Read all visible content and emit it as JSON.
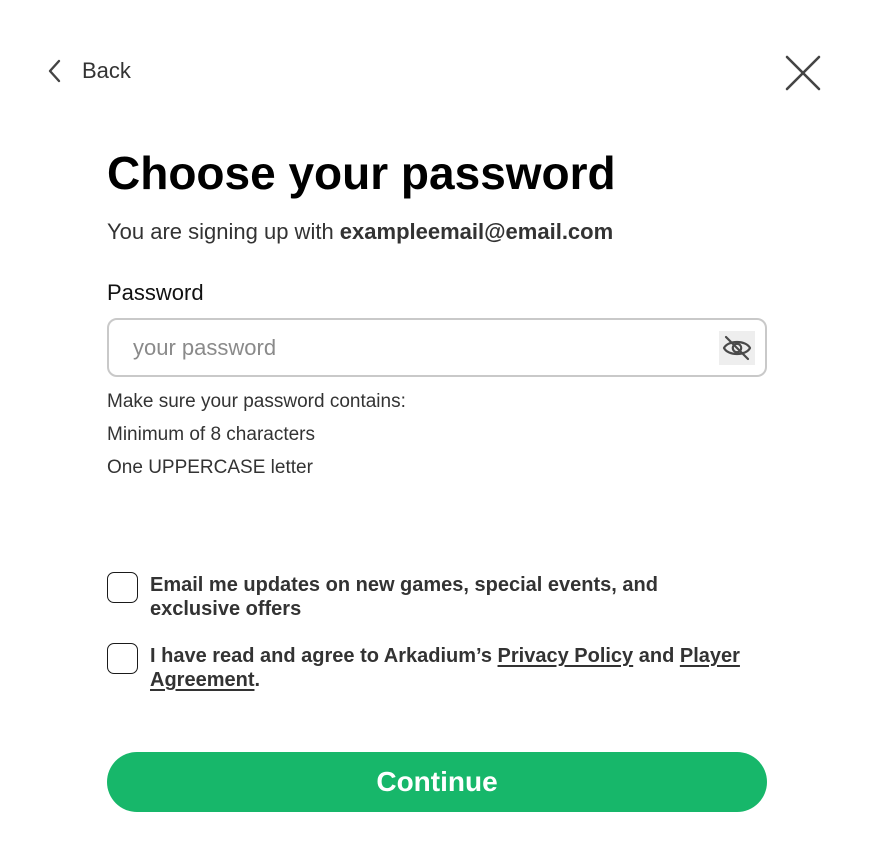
{
  "header": {
    "back_label": "Back",
    "back_icon": "chevron-left-icon",
    "close_icon": "close-icon"
  },
  "title": "Choose your password",
  "subtitle": {
    "prefix": "You are signing up with ",
    "email": "exampleemail@email.com"
  },
  "password_field": {
    "label": "Password",
    "placeholder": "your password",
    "value": "",
    "toggle_icon": "eye-off-icon"
  },
  "requirements": {
    "intro": "Make sure your password contains:",
    "items": [
      "Minimum of 8 characters",
      "One UPPERCASE letter"
    ]
  },
  "consents": [
    {
      "checked": false,
      "text": "Email me updates on new games, special events, and exclusive offers"
    },
    {
      "checked": false,
      "text_before": "I have read and agree to Arkadium’s ",
      "link1": "Privacy Policy",
      "text_middle": " and ",
      "link2": "Player Agreement",
      "text_after": "."
    }
  ],
  "continue_label": "Continue",
  "colors": {
    "primary_button": "#17b76a",
    "input_border": "#c9c9c9",
    "text": "#333333"
  }
}
